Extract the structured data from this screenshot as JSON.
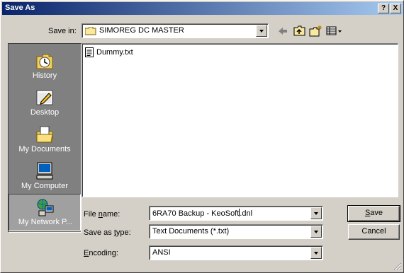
{
  "titlebar": {
    "title": "Save As",
    "help_glyph": "?",
    "close_glyph": "X"
  },
  "toolbar": {
    "save_in_label": "Save in:",
    "save_in_value": "SIMOREG DC MASTER",
    "icons": [
      "back-arrow-icon",
      "up-folder-icon",
      "new-folder-icon",
      "view-menu-icon"
    ]
  },
  "places": [
    {
      "label": "History",
      "icon": "history-icon"
    },
    {
      "label": "Desktop",
      "icon": "desktop-icon"
    },
    {
      "label": "My Documents",
      "icon": "my-documents-icon"
    },
    {
      "label": "My Computer",
      "icon": "my-computer-icon"
    },
    {
      "label": "My Network P...",
      "icon": "network-icon"
    }
  ],
  "files": [
    {
      "name": "Dummy.txt",
      "icon": "text-file-icon"
    }
  ],
  "form": {
    "filename_label_pre": "File ",
    "filename_label_u": "n",
    "filename_label_post": "ame:",
    "filename_value": "6RA70 Backup - KeoSoft",
    "filename_value_after_caret": ".dnl",
    "savetype_label_pre": "Save as ",
    "savetype_label_u": "t",
    "savetype_label_post": "ype:",
    "savetype_value": "Text Documents (*.txt)",
    "encoding_label_u": "E",
    "encoding_label_post": "ncoding:",
    "encoding_value": "ANSI"
  },
  "buttons": {
    "save_u": "S",
    "save_rest": "ave",
    "cancel": "Cancel"
  },
  "colors": {
    "title_start": "#0a246a",
    "title_end": "#a6caf0",
    "face": "#d4d0c8",
    "places_bg": "#808080"
  }
}
